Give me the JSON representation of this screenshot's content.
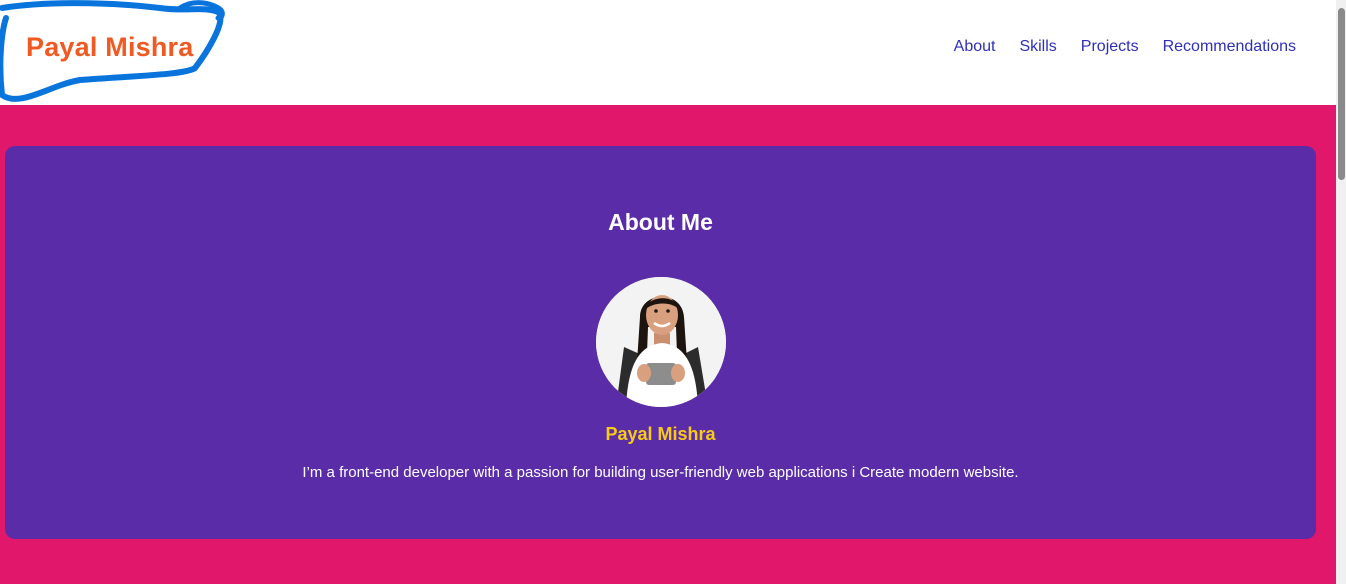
{
  "header": {
    "logo_text": "Payal Mishra",
    "nav": [
      "About",
      "Skills",
      "Projects",
      "Recommendations"
    ]
  },
  "about": {
    "title": "About Me",
    "name": "Payal Mishra",
    "bio": "I’m a front-end developer with a passion for building user-friendly web applications i Create modern website."
  },
  "colors": {
    "logo": "#f05a22",
    "nav": "#2f2fb8",
    "page_background": "#e0176a",
    "card_background": "#5b2ca8",
    "name_accent": "#f7cb15",
    "scribble": "#0a74dd"
  },
  "icons": {
    "logo_annotation": "hand-drawn-scribble-outline"
  }
}
